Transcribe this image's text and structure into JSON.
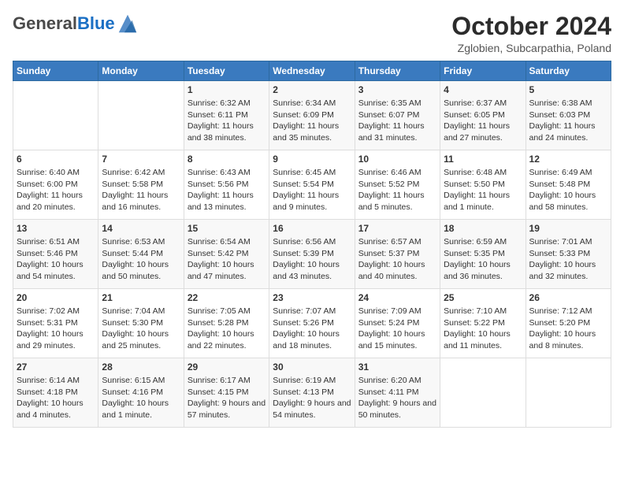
{
  "header": {
    "logo_general": "General",
    "logo_blue": "Blue",
    "month_title": "October 2024",
    "subtitle": "Zglobien, Subcarpathia, Poland"
  },
  "weekdays": [
    "Sunday",
    "Monday",
    "Tuesday",
    "Wednesday",
    "Thursday",
    "Friday",
    "Saturday"
  ],
  "weeks": [
    [
      {
        "day": "",
        "content": ""
      },
      {
        "day": "",
        "content": ""
      },
      {
        "day": "1",
        "content": "Sunrise: 6:32 AM\nSunset: 6:11 PM\nDaylight: 11 hours and 38 minutes."
      },
      {
        "day": "2",
        "content": "Sunrise: 6:34 AM\nSunset: 6:09 PM\nDaylight: 11 hours and 35 minutes."
      },
      {
        "day": "3",
        "content": "Sunrise: 6:35 AM\nSunset: 6:07 PM\nDaylight: 11 hours and 31 minutes."
      },
      {
        "day": "4",
        "content": "Sunrise: 6:37 AM\nSunset: 6:05 PM\nDaylight: 11 hours and 27 minutes."
      },
      {
        "day": "5",
        "content": "Sunrise: 6:38 AM\nSunset: 6:03 PM\nDaylight: 11 hours and 24 minutes."
      }
    ],
    [
      {
        "day": "6",
        "content": "Sunrise: 6:40 AM\nSunset: 6:00 PM\nDaylight: 11 hours and 20 minutes."
      },
      {
        "day": "7",
        "content": "Sunrise: 6:42 AM\nSunset: 5:58 PM\nDaylight: 11 hours and 16 minutes."
      },
      {
        "day": "8",
        "content": "Sunrise: 6:43 AM\nSunset: 5:56 PM\nDaylight: 11 hours and 13 minutes."
      },
      {
        "day": "9",
        "content": "Sunrise: 6:45 AM\nSunset: 5:54 PM\nDaylight: 11 hours and 9 minutes."
      },
      {
        "day": "10",
        "content": "Sunrise: 6:46 AM\nSunset: 5:52 PM\nDaylight: 11 hours and 5 minutes."
      },
      {
        "day": "11",
        "content": "Sunrise: 6:48 AM\nSunset: 5:50 PM\nDaylight: 11 hours and 1 minute."
      },
      {
        "day": "12",
        "content": "Sunrise: 6:49 AM\nSunset: 5:48 PM\nDaylight: 10 hours and 58 minutes."
      }
    ],
    [
      {
        "day": "13",
        "content": "Sunrise: 6:51 AM\nSunset: 5:46 PM\nDaylight: 10 hours and 54 minutes."
      },
      {
        "day": "14",
        "content": "Sunrise: 6:53 AM\nSunset: 5:44 PM\nDaylight: 10 hours and 50 minutes."
      },
      {
        "day": "15",
        "content": "Sunrise: 6:54 AM\nSunset: 5:42 PM\nDaylight: 10 hours and 47 minutes."
      },
      {
        "day": "16",
        "content": "Sunrise: 6:56 AM\nSunset: 5:39 PM\nDaylight: 10 hours and 43 minutes."
      },
      {
        "day": "17",
        "content": "Sunrise: 6:57 AM\nSunset: 5:37 PM\nDaylight: 10 hours and 40 minutes."
      },
      {
        "day": "18",
        "content": "Sunrise: 6:59 AM\nSunset: 5:35 PM\nDaylight: 10 hours and 36 minutes."
      },
      {
        "day": "19",
        "content": "Sunrise: 7:01 AM\nSunset: 5:33 PM\nDaylight: 10 hours and 32 minutes."
      }
    ],
    [
      {
        "day": "20",
        "content": "Sunrise: 7:02 AM\nSunset: 5:31 PM\nDaylight: 10 hours and 29 minutes."
      },
      {
        "day": "21",
        "content": "Sunrise: 7:04 AM\nSunset: 5:30 PM\nDaylight: 10 hours and 25 minutes."
      },
      {
        "day": "22",
        "content": "Sunrise: 7:05 AM\nSunset: 5:28 PM\nDaylight: 10 hours and 22 minutes."
      },
      {
        "day": "23",
        "content": "Sunrise: 7:07 AM\nSunset: 5:26 PM\nDaylight: 10 hours and 18 minutes."
      },
      {
        "day": "24",
        "content": "Sunrise: 7:09 AM\nSunset: 5:24 PM\nDaylight: 10 hours and 15 minutes."
      },
      {
        "day": "25",
        "content": "Sunrise: 7:10 AM\nSunset: 5:22 PM\nDaylight: 10 hours and 11 minutes."
      },
      {
        "day": "26",
        "content": "Sunrise: 7:12 AM\nSunset: 5:20 PM\nDaylight: 10 hours and 8 minutes."
      }
    ],
    [
      {
        "day": "27",
        "content": "Sunrise: 6:14 AM\nSunset: 4:18 PM\nDaylight: 10 hours and 4 minutes."
      },
      {
        "day": "28",
        "content": "Sunrise: 6:15 AM\nSunset: 4:16 PM\nDaylight: 10 hours and 1 minute."
      },
      {
        "day": "29",
        "content": "Sunrise: 6:17 AM\nSunset: 4:15 PM\nDaylight: 9 hours and 57 minutes."
      },
      {
        "day": "30",
        "content": "Sunrise: 6:19 AM\nSunset: 4:13 PM\nDaylight: 9 hours and 54 minutes."
      },
      {
        "day": "31",
        "content": "Sunrise: 6:20 AM\nSunset: 4:11 PM\nDaylight: 9 hours and 50 minutes."
      },
      {
        "day": "",
        "content": ""
      },
      {
        "day": "",
        "content": ""
      }
    ]
  ]
}
